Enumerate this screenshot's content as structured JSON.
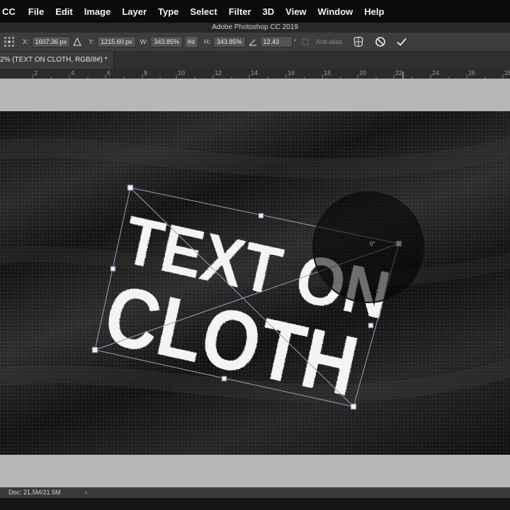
{
  "menubar": {
    "app": "CC",
    "items": [
      "File",
      "Edit",
      "Image",
      "Layer",
      "Type",
      "Select",
      "Filter",
      "3D",
      "View",
      "Window",
      "Help"
    ]
  },
  "window": {
    "title": "Adobe Photoshop CC 2019"
  },
  "options": {
    "x_label": "X:",
    "x_value": "1607.36 px",
    "y_label": "Y:",
    "y_value": "1215.60 px",
    "w_label": "W:",
    "w_value": "343.85%",
    "h_label": "H:",
    "h_value": "343.85%",
    "angle_value": "12.43",
    "angle_unit": "°",
    "antialias_label": "Anti-alias"
  },
  "tab": {
    "title": "2% (TEXT ON  CLOTH, RGB/8#) *"
  },
  "ruler": {
    "ticks": [
      "2",
      "4",
      "6",
      "8",
      "10",
      "12",
      "14",
      "16",
      "18",
      "20",
      "22",
      "24",
      "26",
      "28"
    ]
  },
  "canvas": {
    "text_line1": "TEXT ON",
    "text_line2": "CLOTH",
    "angle_readout": "0°"
  },
  "status": {
    "doc": "Doc: 21.5M/21.5M",
    "arrow": "›"
  }
}
